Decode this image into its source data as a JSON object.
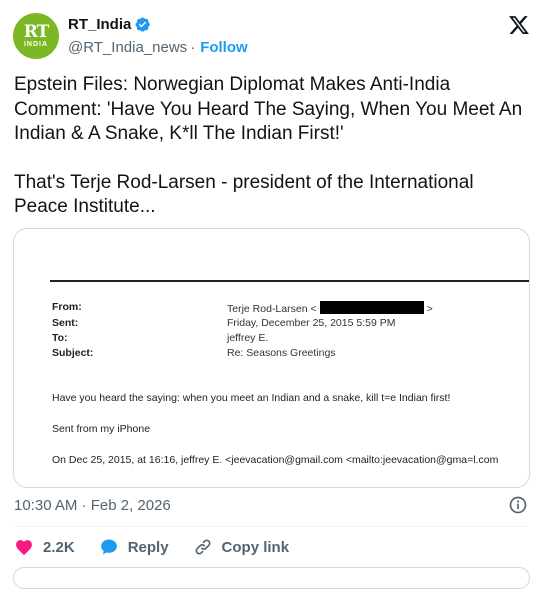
{
  "author": {
    "avatar_text": "RT",
    "avatar_subtext": "INDIA",
    "display_name": "RT_India",
    "handle": "@RT_India_news",
    "separator": "·",
    "follow_label": "Follow",
    "brand_color": "#7cb826"
  },
  "tweet": {
    "paragraph1": "Epstein Files: Norwegian Diplomat Makes Anti-India Comment: 'Have You Heard The Saying, When You Meet An Indian & A Snake, K*ll The Indian First!'",
    "paragraph2": "That's Terje Rod-Larsen - president of the International Peace Institute..."
  },
  "document": {
    "from_label": "From:",
    "from_value": "Terje Rod-Larsen <",
    "from_value_end": ">",
    "sent_label": "Sent:",
    "sent_value": "Friday, December 25, 2015 5:59 PM",
    "to_label": "To:",
    "to_value": "jeffrey E.",
    "subject_label": "Subject:",
    "subject_value": "Re: Seasons Greetings",
    "body_line1": "Have you heard the saying: when you meet an Indian and a snake, kill t=e Indian first!",
    "body_line2": "Sent from my iPhone",
    "body_line3": "On Dec 25, 2015, at 16:16, jeffrey E. <jeevacation@gmail.com <mailto:jeevacation@gma=l.com"
  },
  "meta": {
    "timestamp": "10:30 AM · Feb 2, 2026"
  },
  "actions": {
    "likes": "2.2K",
    "reply_label": "Reply",
    "copy_label": "Copy link"
  },
  "colors": {
    "accent": "#1d9bf0",
    "like": "#f91880",
    "muted": "#536471"
  },
  "icons": [
    "verified-badge-icon",
    "x-logo-icon",
    "info-icon",
    "heart-icon",
    "reply-bubble-icon",
    "link-icon"
  ]
}
